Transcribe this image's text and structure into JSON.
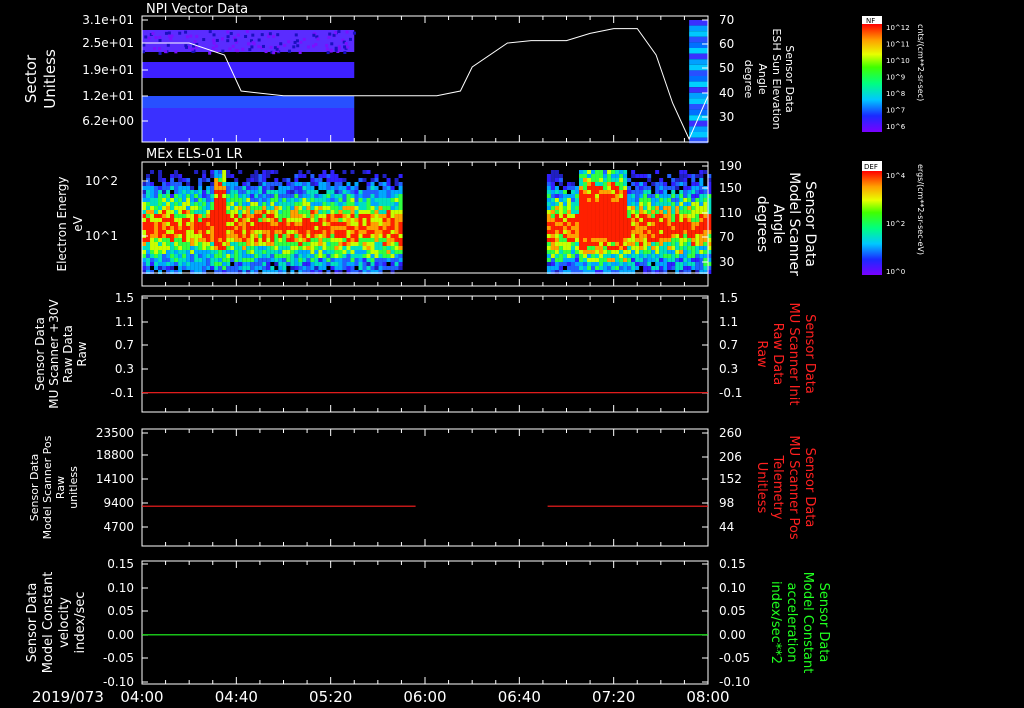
{
  "time_axis": {
    "date_label": "2019/073",
    "tick_labels": [
      "04:00",
      "04:40",
      "05:20",
      "06:00",
      "06:40",
      "07:20",
      "08:00"
    ],
    "start_min": 240,
    "end_min": 480
  },
  "colorbars": {
    "nf": {
      "tag": "NF",
      "unit": "cnts/(cm**2-sr-sec)",
      "tick_labels": [
        "10^12",
        "10^11",
        "10^10",
        "10^9",
        "10^8",
        "10^7",
        "10^6"
      ]
    },
    "def": {
      "tag": "DEF",
      "unit": "ergs/(cm**2-sr-sec-eV)",
      "tick_labels": [
        "10^4",
        "10^2",
        "10^0"
      ]
    }
  },
  "chart_data": [
    {
      "type": "heatmap",
      "title": "NPI Vector Data",
      "left_label": [
        "Sector",
        "Unitless"
      ],
      "right_label": [
        "Sensor Data",
        "ESH Sun Elevation",
        "Angle",
        "degree"
      ],
      "y_tick_labels": [
        "3.1e+01",
        "2.5e+01",
        "1.9e+01",
        "1.2e+01",
        "6.2e+00"
      ],
      "ylim": [
        0,
        31
      ],
      "right_tick_labels": [
        "70",
        "60",
        "50",
        "40",
        "30"
      ],
      "right_ylim": [
        20,
        70
      ],
      "data_gaps_min": [
        [
          330,
          472
        ]
      ],
      "line_series": {
        "color": "#ffffff",
        "x_min": [
          240,
          260,
          275,
          282,
          300,
          350,
          355,
          365,
          375,
          380,
          395,
          405,
          420,
          430,
          440,
          450,
          458,
          465,
          472,
          480
        ],
        "y": [
          60,
          60,
          55,
          40,
          38,
          38,
          38,
          38,
          40,
          50,
          60,
          61,
          61,
          64,
          66,
          66,
          55,
          35,
          20,
          38
        ]
      }
    },
    {
      "type": "heatmap",
      "title": "MEx ELS-01 LR",
      "left_label": [
        "Electron Energy",
        "eV"
      ],
      "right_label": [
        "Sensor Data",
        "Model Scanner",
        "Angle",
        "degrees"
      ],
      "y_tick_labels": [
        "10^2",
        "10^1"
      ],
      "right_tick_labels": [
        "190",
        "150",
        "110",
        "70",
        "30"
      ],
      "right_ylim": [
        10,
        190
      ],
      "data_gaps_min": [
        [
          350,
          411
        ]
      ],
      "hot_spots_min": [
        [
          270,
          274
        ],
        [
          425,
          445
        ]
      ]
    },
    {
      "type": "line",
      "left_label": [
        "Sensor Data",
        "MU Scanner +30V",
        "Raw Data",
        "Raw"
      ],
      "right_label": [
        "Sensor Data",
        "MU Scanner Init",
        "Raw Data",
        "Raw"
      ],
      "y_tick_labels": [
        "1.5",
        "1.1",
        "0.7",
        "0.3",
        "-0.1"
      ],
      "ylim": [
        -0.3,
        1.5
      ],
      "right_tick_labels": [
        "1.5",
        "1.1",
        "0.7",
        "0.3",
        "-0.1"
      ],
      "series": [
        {
          "color": "#ff2020",
          "segments": [
            {
              "x_min": [
                240,
                480
              ],
              "y": [
                0.0,
                0.0
              ]
            }
          ]
        }
      ]
    },
    {
      "type": "line",
      "left_label": [
        "Sensor Data",
        "Model Scanner Pos",
        "Raw",
        "unitless"
      ],
      "right_label": [
        "Sensor Data",
        "MU Scanner Pos",
        "Telemetry",
        "Unitless"
      ],
      "y_tick_labels": [
        "23500",
        "18800",
        "14100",
        "9400",
        "4700"
      ],
      "ylim": [
        0,
        23500
      ],
      "right_tick_labels": [
        "260",
        "206",
        "152",
        "98",
        "44"
      ],
      "series": [
        {
          "color": "#ff2020",
          "segments": [
            {
              "x_min": [
                240,
                356
              ],
              "y": [
                8000,
                8000
              ]
            },
            {
              "x_min": [
                412,
                480
              ],
              "y": [
                8000,
                8000
              ]
            }
          ]
        }
      ]
    },
    {
      "type": "line",
      "left_label": [
        "Sensor Data",
        "Model Constant",
        "velocity",
        "index/sec"
      ],
      "right_label": [
        "Sensor Data",
        "Model Constant",
        "acceleration",
        "index/sec**2"
      ],
      "y_tick_labels": [
        "0.15",
        "0.10",
        "0.05",
        "0.00",
        "-0.05",
        "-0.10"
      ],
      "ylim": [
        -0.1,
        0.15
      ],
      "right_tick_labels": [
        "0.15",
        "0.10",
        "0.05",
        "0.00",
        "-0.05",
        "-0.10"
      ],
      "series": [
        {
          "color": "#20ff20",
          "segments": [
            {
              "x_min": [
                240,
                480
              ],
              "y": [
                0,
                0
              ]
            }
          ]
        }
      ]
    }
  ]
}
